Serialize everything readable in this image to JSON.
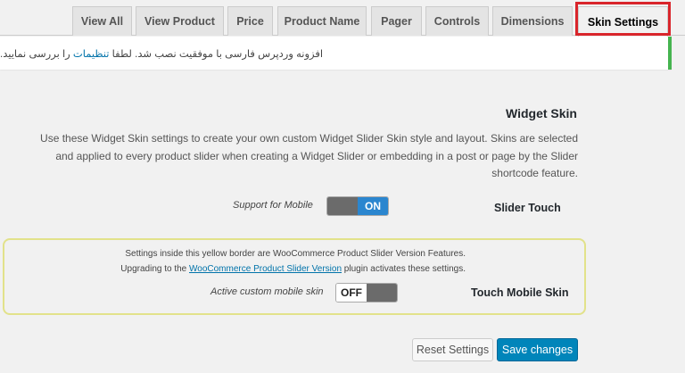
{
  "tabs": [
    {
      "label": "View All"
    },
    {
      "label": "View Product"
    },
    {
      "label": "Price"
    },
    {
      "label": "Product Name"
    },
    {
      "label": "Pager"
    },
    {
      "label": "Controls"
    },
    {
      "label": "Dimensions"
    },
    {
      "label": "Skin Settings",
      "active": true
    }
  ],
  "notice": {
    "text_before": "افزونه وردپرس فارسی با موفقیت نصب شد. لطفا ",
    "link": "تنظیمات",
    "text_after": " را بررسی نمایید."
  },
  "section": {
    "title": "Widget Skin",
    "description": "Use these Widget Skin settings to create your own custom Widget Slider Skin style and layout. Skins are selected and applied to every product slider when creating a Widget Slider or embedding in a post or page by the Slider shortcode feature."
  },
  "slider_touch": {
    "label": "Slider Touch",
    "hint": "Support for Mobile",
    "toggle_state": "ON"
  },
  "pro_box": {
    "line1": "Settings inside this yellow border are WooCommerce Product Slider Version Features.",
    "line2_before": "Upgrading to the ",
    "line2_link": "WooCommerce Product Slider Version",
    "line2_after": " plugin activates these settings."
  },
  "touch_mobile_skin": {
    "label": "Touch Mobile Skin",
    "hint": "Active custom mobile skin",
    "toggle_state": "OFF"
  },
  "buttons": {
    "reset": "Reset Settings",
    "save": "Save changes"
  },
  "colors": {
    "accent": "#0085ba",
    "toggle_on": "#2b86cf",
    "notice_border": "#46b450",
    "highlight": "#d9252b",
    "pro_border": "#e2e28a"
  }
}
